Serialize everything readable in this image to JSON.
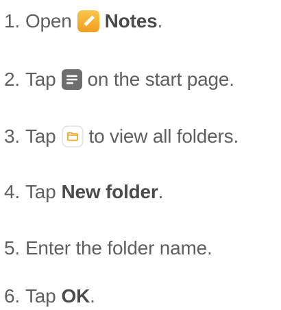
{
  "steps": [
    {
      "num": "1.",
      "pre": "Open",
      "icon": "notes-app-icon",
      "bold": "Notes",
      "post": "."
    },
    {
      "num": "2.",
      "pre": "Tap",
      "icon": "list-menu-icon",
      "post": "on the start page."
    },
    {
      "num": "3.",
      "pre": "Tap",
      "icon": "folder-button-icon",
      "post": "to view all folders."
    },
    {
      "num": "4.",
      "pre": "Tap",
      "bold": "New folder",
      "post": "."
    },
    {
      "num": "5.",
      "text": "Enter the folder name."
    },
    {
      "num": "6.",
      "pre": "Tap",
      "bold": "OK",
      "post": "."
    }
  ],
  "colors": {
    "text": "#5f5f5f",
    "notes_icon_bg": "#f7b731",
    "list_icon_bg": "#6e6e6e",
    "folder_icon_accent": "#f2a627"
  }
}
